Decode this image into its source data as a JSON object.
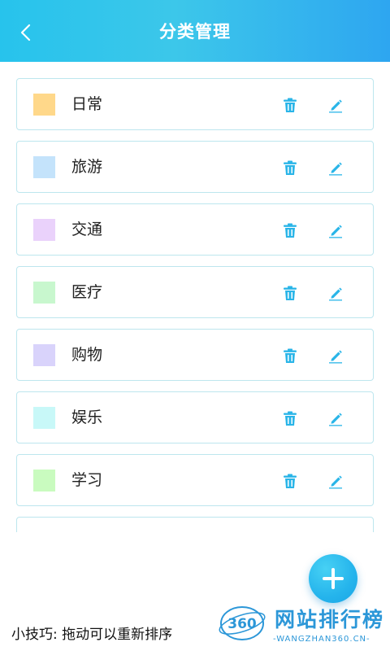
{
  "header": {
    "title": "分类管理",
    "back_icon": "chevron-left-icon"
  },
  "categories": [
    {
      "name": "日常",
      "color": "#ffd88a"
    },
    {
      "name": "旅游",
      "color": "#c4e3fb"
    },
    {
      "name": "交通",
      "color": "#ead2fb"
    },
    {
      "name": "医疗",
      "color": "#c8f7ce"
    },
    {
      "name": "购物",
      "color": "#d9d3fb"
    },
    {
      "name": "娱乐",
      "color": "#c8f8f8"
    },
    {
      "name": "学习",
      "color": "#c9fbbf"
    }
  ],
  "colors": {
    "accent": "#2ab6ee",
    "card_border": "#bde6ee",
    "icon": "#2ab5e8"
  },
  "actions": {
    "delete_icon": "trash-icon",
    "edit_icon": "pencil-icon"
  },
  "fab": {
    "icon": "plus-icon"
  },
  "tip": "小技巧: 拖动可以重新排序",
  "watermark": {
    "badge": "360",
    "title": "网站排行榜",
    "subtitle": "-WANGZHAN360.CN-"
  }
}
